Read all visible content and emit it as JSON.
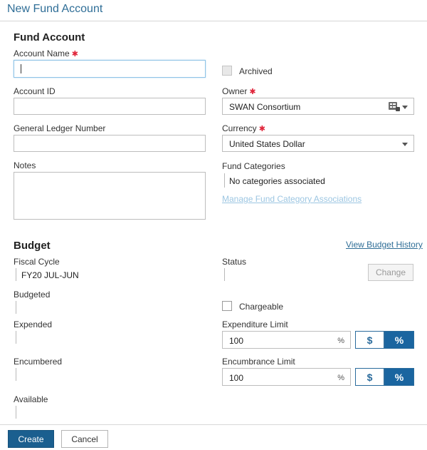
{
  "header": {
    "title": "New Fund Account"
  },
  "fund_account": {
    "section_title": "Fund Account",
    "account_name": {
      "label": "Account Name",
      "value": ""
    },
    "archived": {
      "label": "Archived",
      "checked": false
    },
    "account_id": {
      "label": "Account ID",
      "value": ""
    },
    "owner": {
      "label": "Owner",
      "value": "SWAN Consortium"
    },
    "general_ledger": {
      "label": "General Ledger Number",
      "value": ""
    },
    "currency": {
      "label": "Currency",
      "value": "United States Dollar"
    },
    "notes": {
      "label": "Notes",
      "value": ""
    },
    "fund_categories": {
      "label": "Fund Categories",
      "value": "No categories associated",
      "manage_link": "Manage Fund Category Associations"
    }
  },
  "budget": {
    "section_title": "Budget",
    "view_history_link": "View Budget History",
    "fiscal_cycle": {
      "label": "Fiscal Cycle",
      "value": "FY20 JUL-JUN"
    },
    "status": {
      "label": "Status",
      "value": ""
    },
    "change_button": "Change",
    "budgeted": {
      "label": "Budgeted",
      "value": ""
    },
    "chargeable": {
      "label": "Chargeable",
      "checked": false
    },
    "expended": {
      "label": "Expended",
      "value": ""
    },
    "expenditure_limit": {
      "label": "Expenditure Limit",
      "value": "100",
      "unit": "%"
    },
    "encumbered": {
      "label": "Encumbered",
      "value": ""
    },
    "encumbrance_limit": {
      "label": "Encumbrance Limit",
      "value": "100",
      "unit": "%"
    },
    "available": {
      "label": "Available",
      "value": ""
    },
    "toggle_dollar": "$",
    "toggle_percent": "%"
  },
  "footer": {
    "create_label": "Create",
    "cancel_label": "Cancel"
  },
  "colors": {
    "accent": "#1a65a0",
    "header_title": "#2f6e97",
    "required": "#e0243a"
  },
  "icons": {
    "owner_picker": "org-list-icon",
    "dropdown": "chevron-down-icon",
    "required": "asterisk-icon"
  }
}
